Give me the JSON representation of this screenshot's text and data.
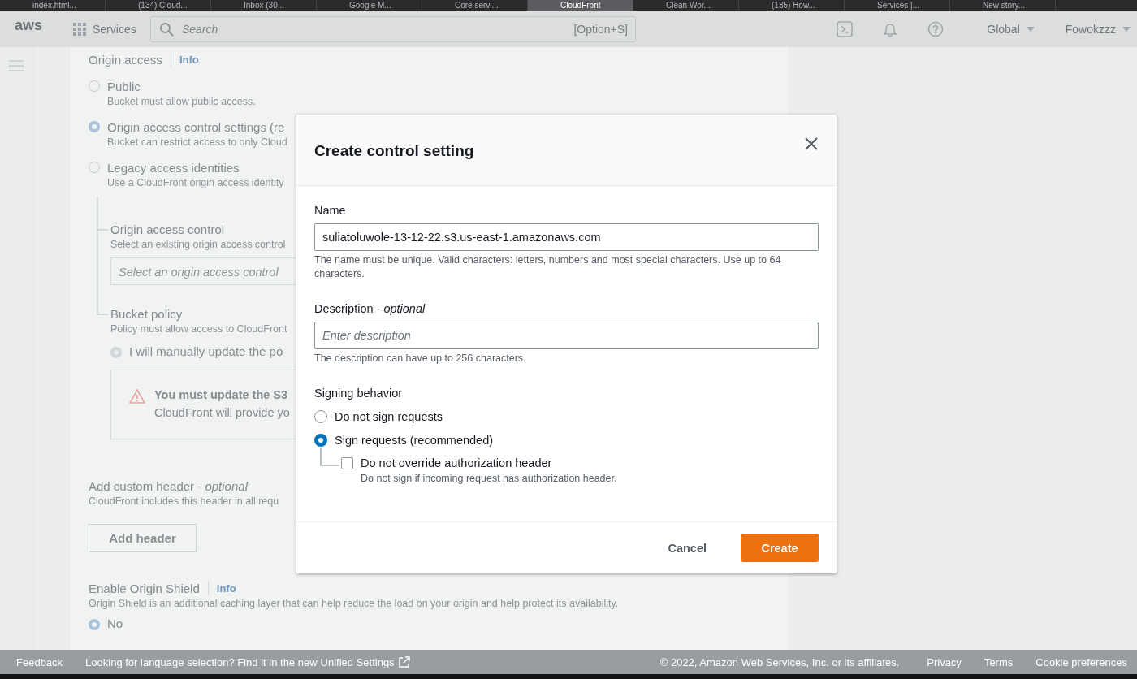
{
  "browser_tabs": [
    {
      "label": "index.html...",
      "selected": false
    },
    {
      "label": "(134) Cloud...",
      "selected": false
    },
    {
      "label": "Inbox (30...",
      "selected": false
    },
    {
      "label": "Google M...",
      "selected": false
    },
    {
      "label": "Core servi...",
      "selected": false
    },
    {
      "label": "CloudFront",
      "selected": true
    },
    {
      "label": "Clean Wor...",
      "selected": false
    },
    {
      "label": "(135) How...",
      "selected": false
    },
    {
      "label": "Services |...",
      "selected": false
    },
    {
      "label": "New story...",
      "selected": false
    }
  ],
  "top_nav": {
    "logo": "aws",
    "services": "Services",
    "search": {
      "placeholder": "Search",
      "shortcut": "[Option+S]"
    },
    "region": "Global",
    "account": "Fowokzzz"
  },
  "page": {
    "origin_access": {
      "title": "Origin access",
      "info": "Info",
      "options": [
        {
          "label": "Public",
          "description": "Bucket must allow public access.",
          "selected": false
        },
        {
          "label": "Origin access control settings (re",
          "description": "Bucket can restrict access to only Cloud",
          "selected": true
        },
        {
          "label": "Legacy access identities",
          "description": "Use a CloudFront origin access identity",
          "selected": false
        }
      ]
    },
    "origin_access_control": {
      "label": "Origin access control",
      "description": "Select an existing origin access control",
      "placeholder": "Select an origin access control"
    },
    "bucket_policy": {
      "label": "Bucket policy",
      "description": "Policy must allow access to CloudFront",
      "option": {
        "label": "I will manually update the po",
        "selected": true
      }
    },
    "alert": {
      "title": "You must update the S3",
      "text": "CloudFront will provide yo"
    },
    "custom_header": {
      "label": "Add custom header - *optional*",
      "description": "CloudFront includes this header in all requ",
      "button": "Add header"
    },
    "origin_shield": {
      "title": "Enable Origin Shield",
      "info": "Info",
      "description": "Origin Shield is an additional caching layer that can help reduce the load on your origin and help protect its availability.",
      "options": [
        {
          "label": "No",
          "selected": true
        }
      ]
    }
  },
  "modal": {
    "title": "Create control setting",
    "name": {
      "label": "Name",
      "value": "suliatoluwole-13-12-22.s3.us-east-1.amazonaws.com",
      "hint": "The name must be unique. Valid characters: letters, numbers and most special characters. Use up to 64 characters."
    },
    "description": {
      "label": "Description - *optional*",
      "placeholder": "Enter description",
      "hint": "The description can have up to 256 characters."
    },
    "signing": {
      "label": "Signing behavior",
      "options": [
        {
          "label": "Do not sign requests",
          "selected": false
        },
        {
          "label": "Sign requests (recommended)",
          "selected": true
        }
      ],
      "checkbox": {
        "label": "Do not override authorization header",
        "description": "Do not sign if incoming request has authorization header.",
        "checked": false
      }
    },
    "buttons": [
      {
        "kind": "secondary",
        "label": "Cancel"
      },
      {
        "kind": "primary",
        "label": "Create"
      }
    ]
  },
  "footer": {
    "feedback": "Feedback",
    "notice": "Looking for language selection? Find it in the new",
    "notice_link": "Unified Settings",
    "copyright": "© 2022, Amazon Web Services, Inc. or its affiliates.",
    "links": [
      "Privacy",
      "Terms",
      "Cookie preferences"
    ]
  }
}
